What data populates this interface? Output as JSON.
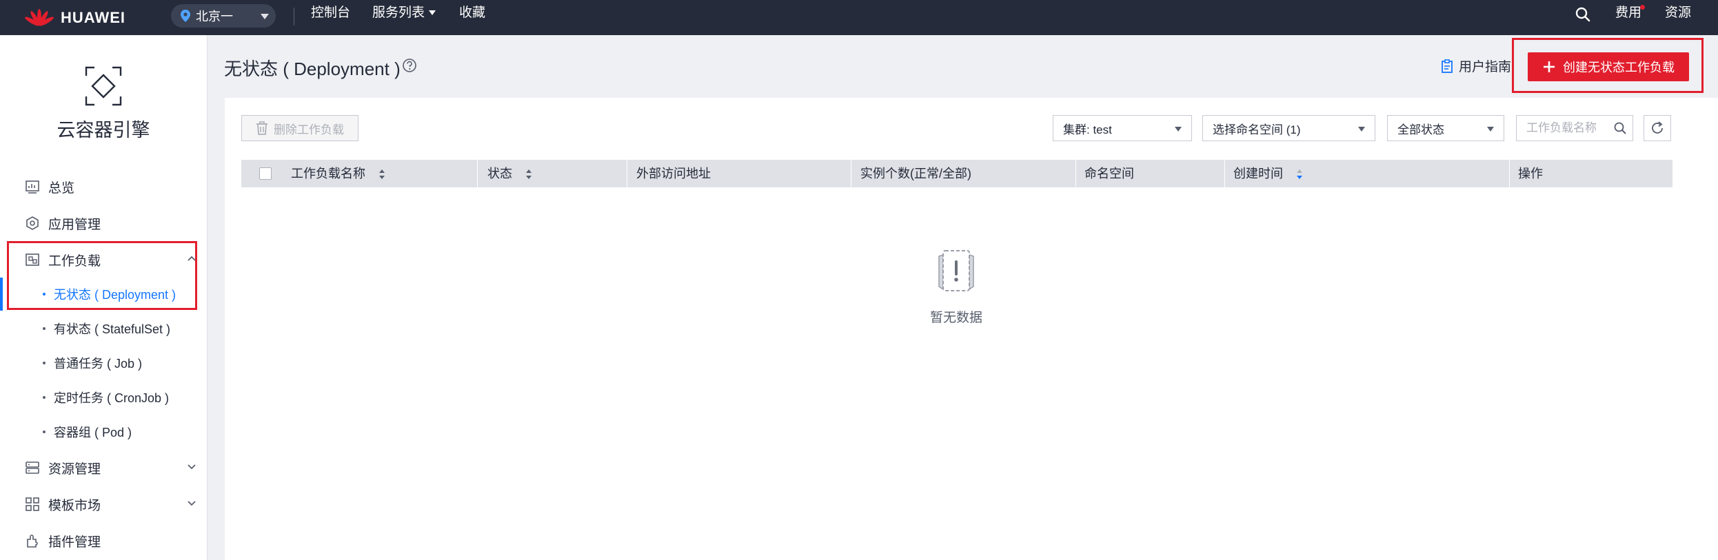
{
  "topbar": {
    "brand": "HUAWEI",
    "region": "北京一",
    "nav": [
      "控制台",
      "服务列表",
      "收藏"
    ],
    "right": [
      "费用",
      "资源"
    ]
  },
  "sidebar": {
    "service_title": "云容器引擎",
    "items": [
      {
        "label": "总览",
        "icon": "dashboard-icon"
      },
      {
        "label": "应用管理",
        "icon": "app-manage-icon"
      },
      {
        "label": "工作负载",
        "icon": "workload-icon"
      },
      {
        "label": "资源管理",
        "icon": "resource-icon"
      },
      {
        "label": "模板市场",
        "icon": "template-icon"
      },
      {
        "label": "插件管理",
        "icon": "plugin-icon"
      }
    ],
    "sub_items": [
      {
        "label": "无状态 ( Deployment )"
      },
      {
        "label": "有状态 ( StatefulSet )"
      },
      {
        "label": "普通任务 ( Job )"
      },
      {
        "label": "定时任务 ( CronJob )"
      },
      {
        "label": "容器组 ( Pod )"
      }
    ]
  },
  "header": {
    "title": "无状态 ( Deployment )",
    "guide_label": "用户指南",
    "create_label": "创建无状态工作负载"
  },
  "toolbar": {
    "delete_label": "删除工作负载",
    "cluster_select": "集群:  test",
    "namespace_select": "选择命名空间 (1)",
    "status_select": "全部状态",
    "search_placeholder": "工作负载名称"
  },
  "table": {
    "columns": [
      "工作负载名称",
      "状态",
      "外部访问地址",
      "实例个数(正常/全部)",
      "命名空间",
      "创建时间",
      "操作"
    ]
  },
  "empty": {
    "text": "暂无数据"
  },
  "colors": {
    "topbar": "#252b3a",
    "brand_red": "#e21e2d",
    "active_blue": "#1476ff"
  }
}
